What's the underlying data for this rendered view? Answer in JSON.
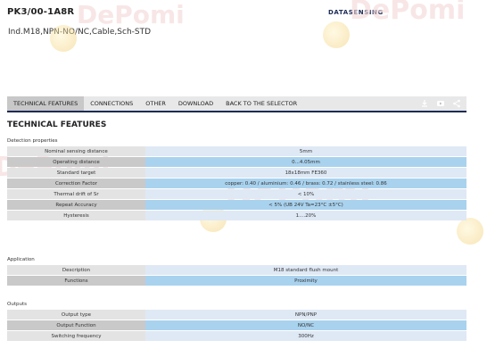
{
  "header": {
    "title": "PK3/00-1A8R",
    "subtitle": "Ind.M18,NPN-NO/NC,Cable,Sch-STD",
    "brand": "DATASENSING"
  },
  "watermark": {
    "text": "DePomi"
  },
  "tabs": [
    {
      "label": "TECHNICAL FEATURES",
      "active": true
    },
    {
      "label": "CONNECTIONS",
      "active": false
    },
    {
      "label": "OTHER",
      "active": false
    },
    {
      "label": "DOWNLOAD",
      "active": false
    },
    {
      "label": "BACK TO THE SELECTOR",
      "active": false
    }
  ],
  "tab_icons": [
    "download-icon",
    "video-icon",
    "share-icon"
  ],
  "section_title": "TECHNICAL FEATURES",
  "groups": [
    {
      "label": "Detection properties",
      "rows": [
        {
          "label": "Nominal sensing distance",
          "value": "5mm"
        },
        {
          "label": "Operating distance",
          "value": "0...4.05mm"
        },
        {
          "label": "Standard target",
          "value": "18x18mm FE360"
        },
        {
          "label": "Correction Factor",
          "value": "copper: 0.40 / aluminium: 0.46 / brass: 0.72 / stainless steel: 0.86"
        },
        {
          "label": "Thermal drift of Sr",
          "value": "< 10%"
        },
        {
          "label": "Repeat Accuracy",
          "value": "< 5% (UB 24V Ta=23°C ±5°C)"
        },
        {
          "label": "Hysteresis",
          "value": "1....20%"
        }
      ]
    },
    {
      "label": "Application",
      "rows": [
        {
          "label": "Description",
          "value": "M18 standard flush mount"
        },
        {
          "label": "Functions",
          "value": "Proximity"
        }
      ]
    },
    {
      "label": "Outputs",
      "rows": [
        {
          "label": "Output type",
          "value": "NPN/PNP"
        },
        {
          "label": "Output Function",
          "value": "NO/NC"
        },
        {
          "label": "Switching frequency",
          "value": "300Hz"
        }
      ]
    }
  ],
  "colors": {
    "navy": "#1d2b56",
    "label_light": "#e3e3e3",
    "label_dark": "#c9c9c9",
    "value_light": "#dfe9f5",
    "value_dark": "#a9d2ee"
  }
}
